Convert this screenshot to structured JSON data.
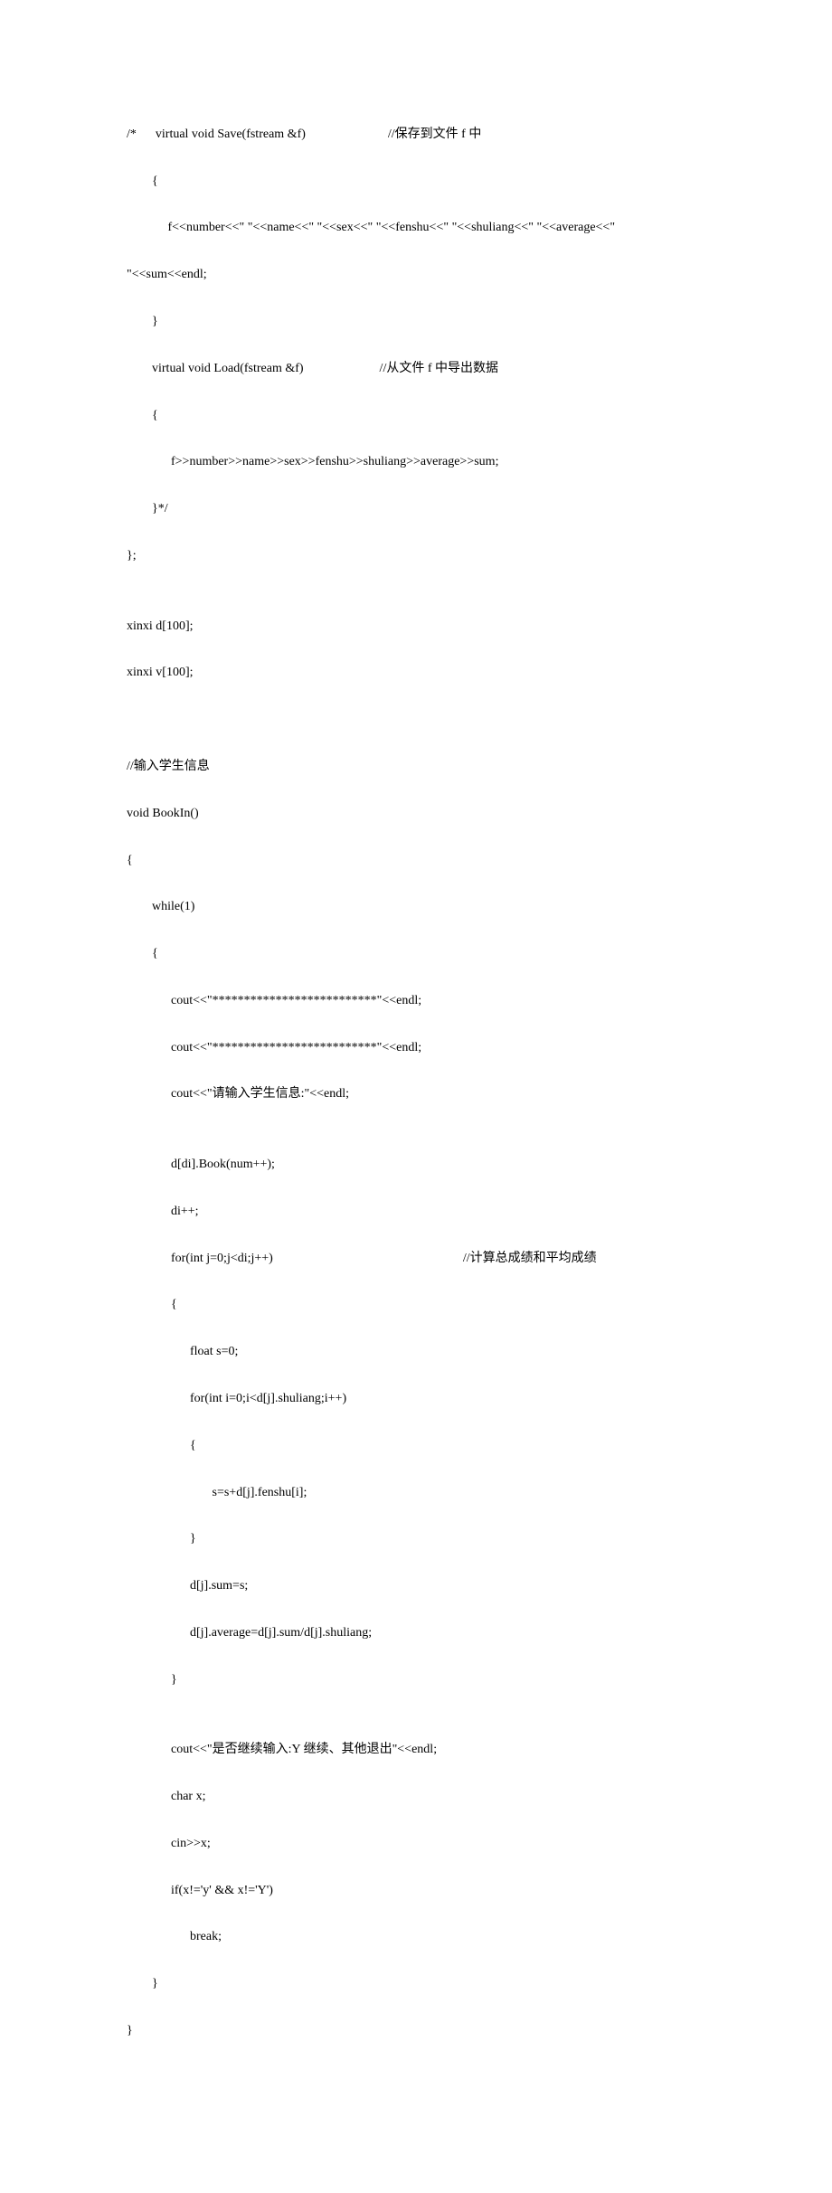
{
  "code": {
    "lines": [
      "/*      virtual void Save(fstream &f)                          //保存到文件 f 中",
      "        {",
      "             f<<number<<\" \"<<name<<\" \"<<sex<<\" \"<<fenshu<<\" \"<<shuliang<<\" \"<<average<<\"",
      "\"<<sum<<endl;",
      "        }",
      "        virtual void Load(fstream &f)                        //从文件 f 中导出数据",
      "        {",
      "              f>>number>>name>>sex>>fenshu>>shuliang>>average>>sum;",
      "        }*/",
      "};",
      "",
      "xinxi d[100];",
      "xinxi v[100];",
      "",
      "",
      "//输入学生信息",
      "void BookIn()",
      "{",
      "        while(1)",
      "        {",
      "              cout<<\"**************************\"<<endl;",
      "              cout<<\"**************************\"<<endl;",
      "              cout<<\"请输入学生信息:\"<<endl;",
      "",
      "              d[di].Book(num++);",
      "              di++;",
      "              for(int j=0;j<di;j++)                                                            //计算总成绩和平均成绩",
      "              {",
      "                    float s=0;",
      "                    for(int i=0;i<d[j].shuliang;i++)",
      "                    {",
      "                           s=s+d[j].fenshu[i];",
      "                    }",
      "                    d[j].sum=s;",
      "                    d[j].average=d[j].sum/d[j].shuliang;",
      "              }",
      "",
      "              cout<<\"是否继续输入:Y 继续、其他退出\"<<endl;",
      "              char x;",
      "              cin>>x;",
      "              if(x!='y' && x!='Y')",
      "                    break;",
      "        }",
      "}"
    ]
  }
}
